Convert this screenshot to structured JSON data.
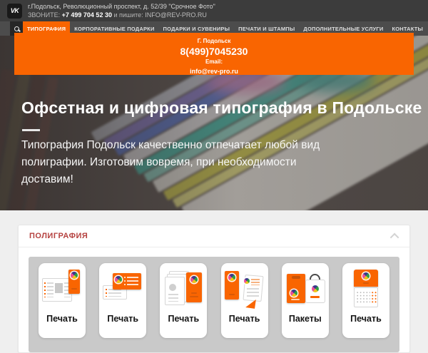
{
  "colors": {
    "accent_orange": "#f96501",
    "section_title_red": "#b5413f",
    "topbar_bg": "#3c3c3c",
    "navbar_bg": "#4c4c4c",
    "page_bg": "#efefef",
    "tile_strip_bg": "#c9c9c9"
  },
  "topbar": {
    "vk_icon": "vk-icon",
    "address": "г.Подольск, Революционный проспект, д. 52/39 \"Срочное Фото\"",
    "call_label": "ЗВОНИТЕ:",
    "phone": "+7 499 704 52 30",
    "write_label": "и пишите:",
    "email": "INFO@REV-PRO.RU"
  },
  "nav": {
    "search_icon": "search-icon",
    "items": [
      {
        "label": "ТИПОГРАФИЯ",
        "active": true
      },
      {
        "label": "КОРПОРАТИВНЫЕ ПОДАРКИ",
        "active": false
      },
      {
        "label": "ПОДАРКИ И СУВЕНИРЫ",
        "active": false
      },
      {
        "label": "ПЕЧАТИ И ШТАМПЫ",
        "active": false
      },
      {
        "label": "ДОПОЛНИТЕЛЬНЫЕ УСЛУГИ",
        "active": false
      },
      {
        "label": "КОНТАКТЫ",
        "active": false
      }
    ]
  },
  "contact_panel": {
    "city": "Г. Подольск",
    "phone": "8(499)7045230",
    "email_label": "Email:",
    "email": "info@rev-pro.ru"
  },
  "hero": {
    "title": "Офсетная и цифровая типография в Подольске",
    "subtitle": "Типография Подольск качественно отпечатает любой вид полиграфии. Изготовим вовремя, при необходимости доставим!"
  },
  "polygraphy": {
    "title": "ПОЛИГРАФИЯ",
    "collapse_icon": "chevron-up-icon",
    "products": [
      {
        "label": "Печать",
        "icon": "letterhead-print-icon"
      },
      {
        "label": "Печать",
        "icon": "business-cards-icon"
      },
      {
        "label": "Печать",
        "icon": "paper-stack-icon"
      },
      {
        "label": "Печать",
        "icon": "brochure-icon"
      },
      {
        "label": "Пакеты",
        "icon": "bags-icon"
      },
      {
        "label": "Печать",
        "icon": "calendar-icon"
      }
    ]
  }
}
